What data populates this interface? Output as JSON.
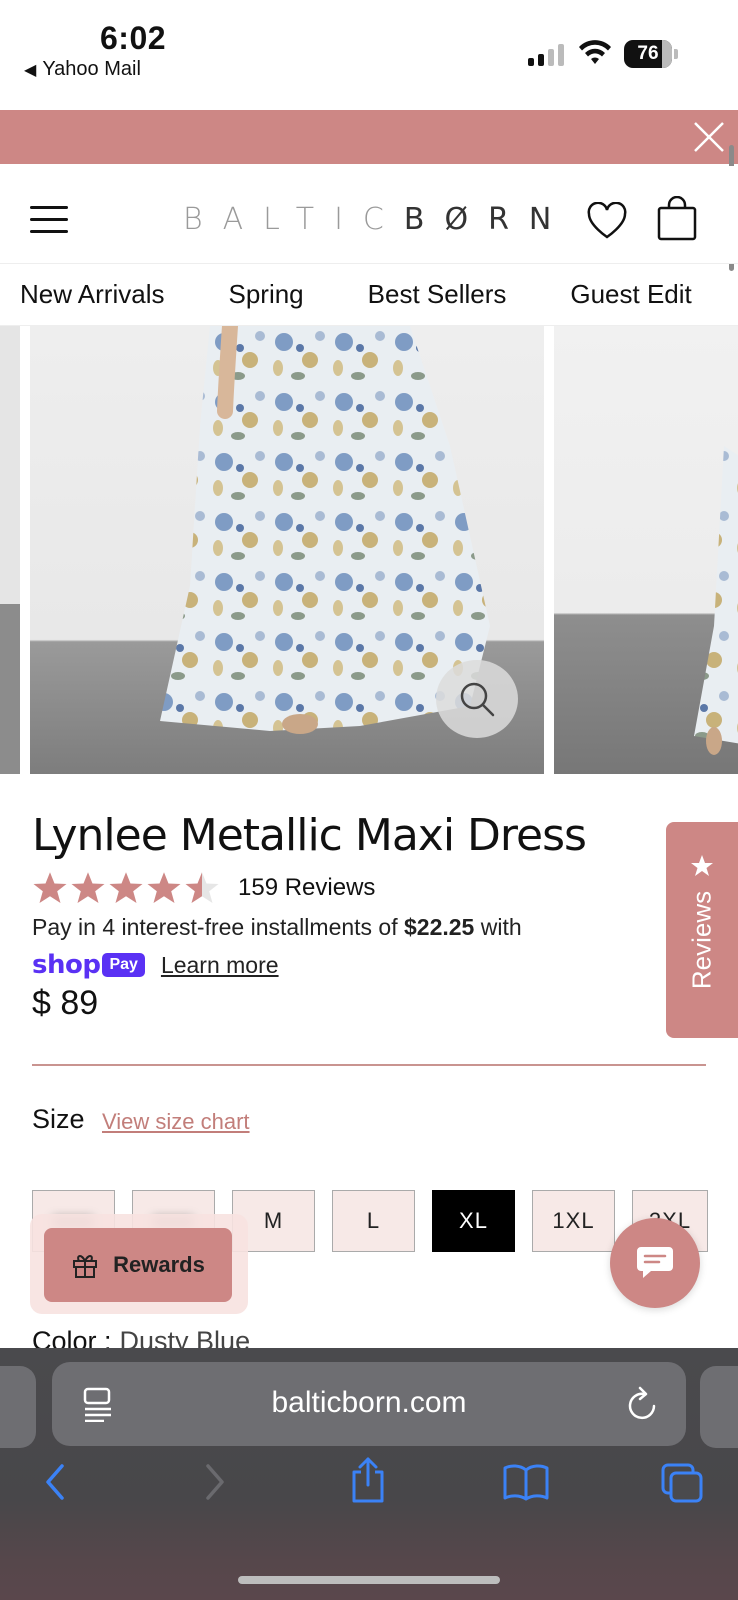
{
  "status_bar": {
    "time": "6:02",
    "back_app": "Yahoo Mail",
    "battery": "76"
  },
  "header": {
    "logo_light": "BALTIC",
    "logo_dark": "BØRN"
  },
  "category_nav": [
    "New Arrivals",
    "Spring",
    "Best Sellers",
    "Guest Edit"
  ],
  "product": {
    "title": "Lynlee Metallic Maxi Dress",
    "rating": 4.5,
    "review_count": "159 Reviews",
    "installments_prefix": "Pay in 4 interest-free installments of ",
    "installment_amount": "$22.25",
    "installments_suffix": " with",
    "shop_pay_word": "shop",
    "shop_pay_pill": "Pay",
    "learn_more": "Learn more",
    "price": "$ 89",
    "size_label": "Size",
    "size_chart_link": "View size chart",
    "sizes": [
      "XS",
      "S",
      "M",
      "L",
      "XL",
      "1XL",
      "2XL"
    ],
    "selected_size": "XL",
    "color_label": "Color :",
    "color_value": "Dusty Blue"
  },
  "reviews_tab": "Reviews",
  "rewards_label": "Rewards",
  "browser": {
    "url": "balticborn.com"
  },
  "colors": {
    "brand_rose": "#cd8785",
    "shop_pay_purple": "#5a31f4",
    "ios_blue": "#3b82f6"
  },
  "icons": [
    "back-triangle-icon",
    "cellular-signal-icon",
    "wifi-icon",
    "battery-icon",
    "close-icon",
    "hamburger-menu-icon",
    "heart-icon",
    "shopping-bag-icon",
    "zoom-icon",
    "star-icon",
    "gift-icon",
    "chat-icon",
    "reader-icon",
    "reload-icon",
    "back-arrow-icon",
    "forward-arrow-icon",
    "share-icon",
    "bookmarks-icon",
    "tabs-icon"
  ]
}
